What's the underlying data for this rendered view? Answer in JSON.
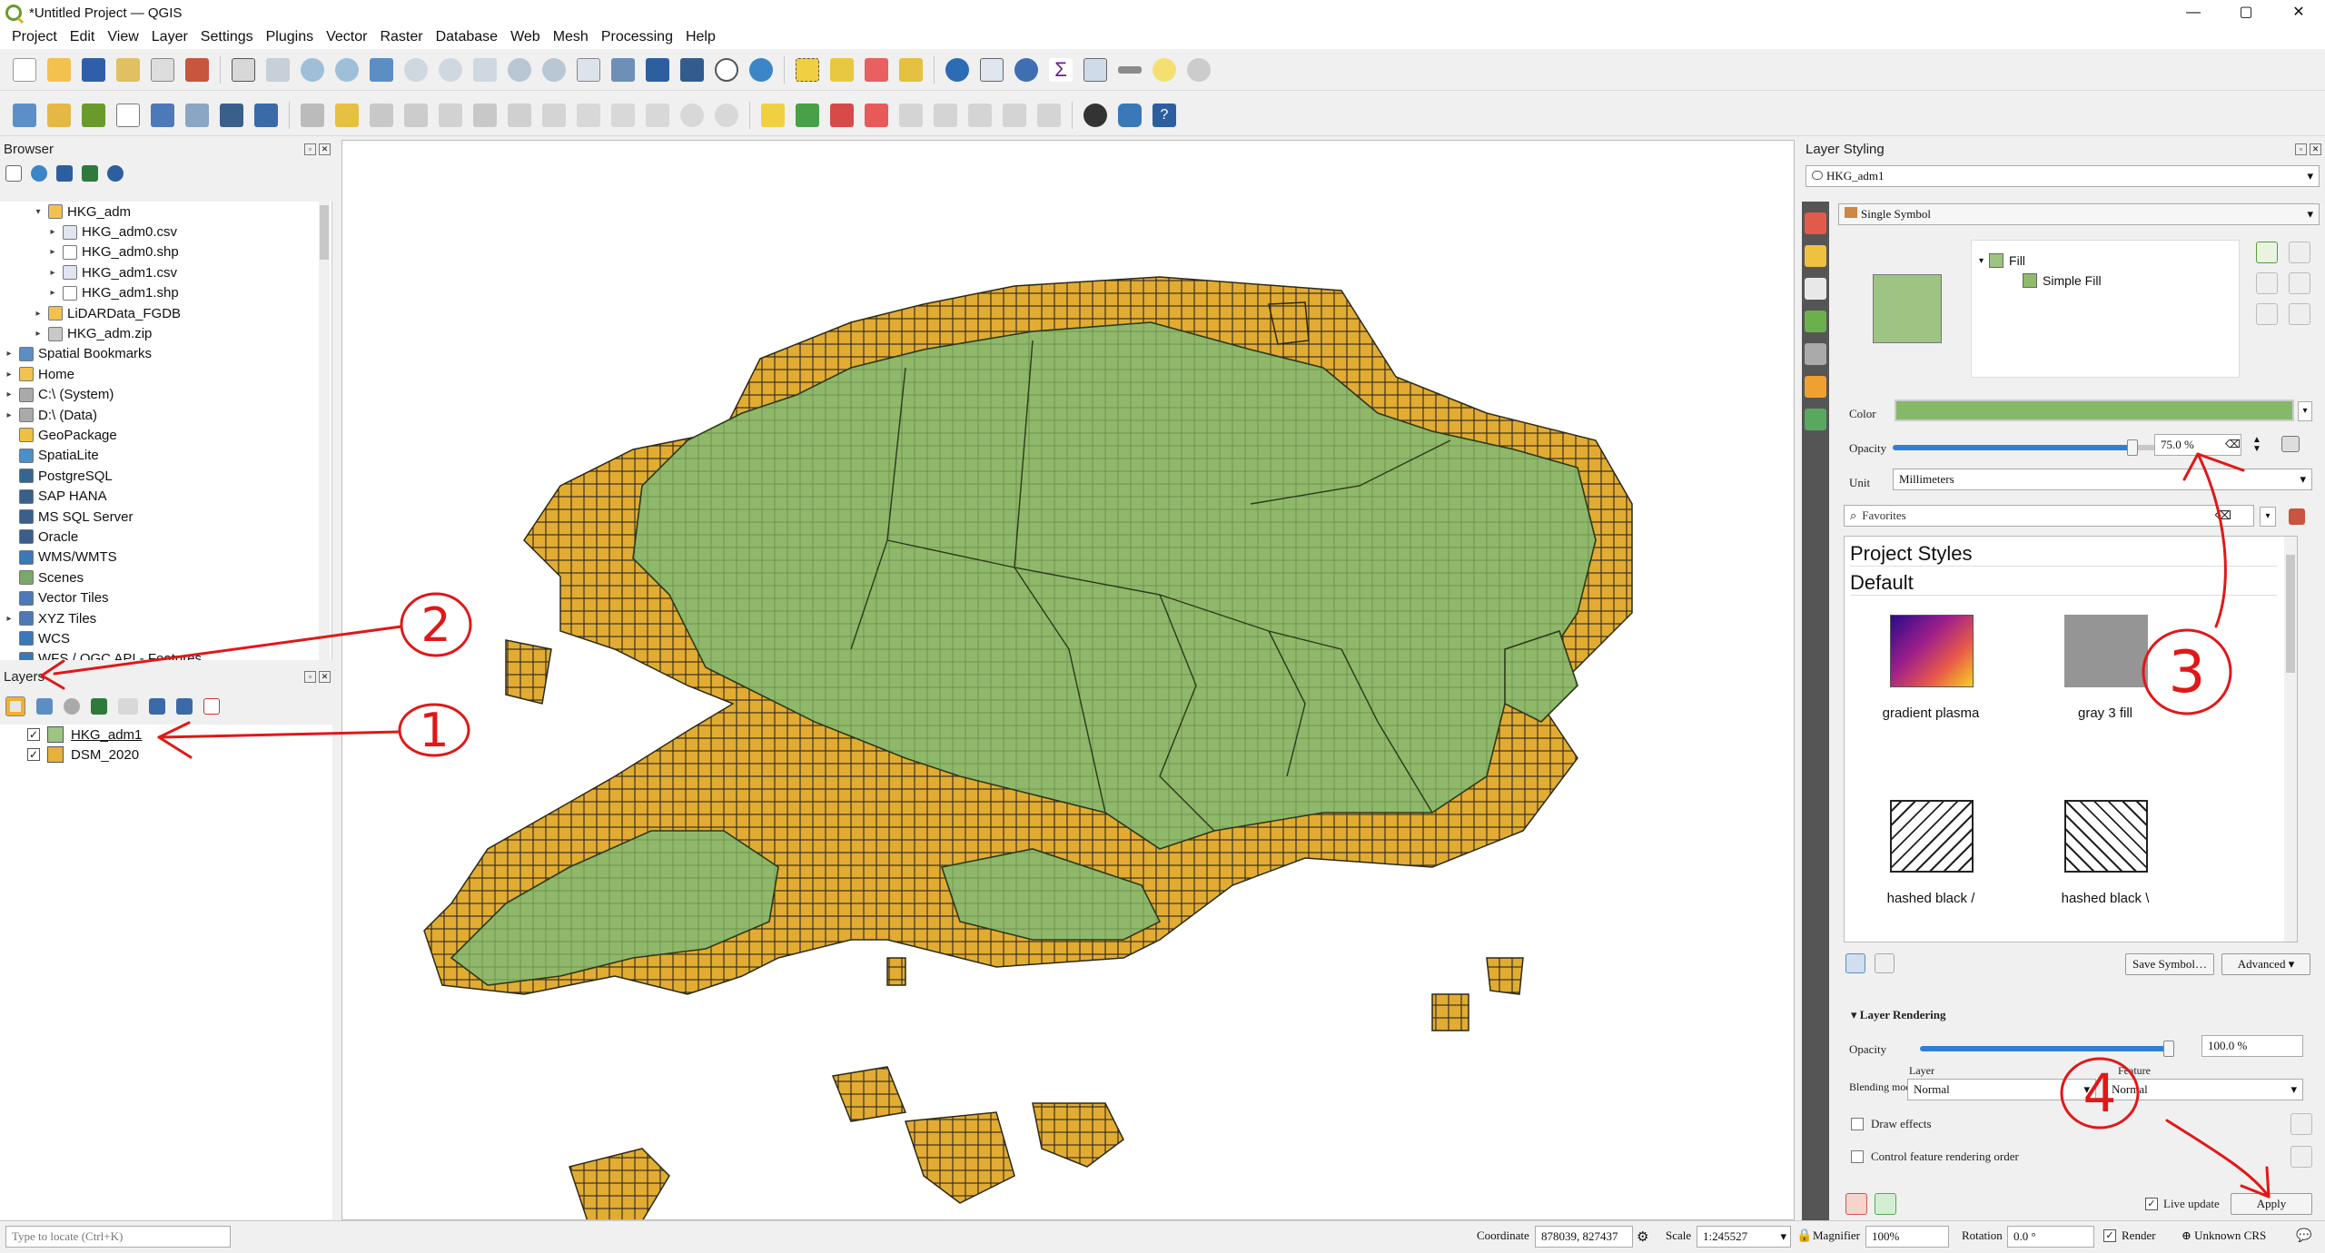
{
  "window": {
    "title": "*Untitled Project — QGIS",
    "minimize": "—",
    "maximize": "▢",
    "close": "✕"
  },
  "menu": [
    "Project",
    "Edit",
    "View",
    "Layer",
    "Settings",
    "Plugins",
    "Vector",
    "Raster",
    "Database",
    "Web",
    "Mesh",
    "Processing",
    "Help"
  ],
  "browser": {
    "title": "Browser",
    "items": [
      {
        "label": "HKG_adm",
        "arrow": "▾",
        "indent": 2,
        "icon": "folder-icon"
      },
      {
        "label": "HKG_adm0.csv",
        "arrow": "▸",
        "indent": 3,
        "icon": "table-icon"
      },
      {
        "label": "HKG_adm0.shp",
        "arrow": "▸",
        "indent": 3,
        "icon": "vector-icon"
      },
      {
        "label": "HKG_adm1.csv",
        "arrow": "▸",
        "indent": 3,
        "icon": "table-icon"
      },
      {
        "label": "HKG_adm1.shp",
        "arrow": "▸",
        "indent": 3,
        "icon": "vector-icon"
      },
      {
        "label": "LiDARData_FGDB",
        "arrow": "▸",
        "indent": 2,
        "icon": "folder-icon"
      },
      {
        "label": "HKG_adm.zip",
        "arrow": "▸",
        "indent": 2,
        "icon": "zip-icon"
      },
      {
        "label": "Spatial Bookmarks",
        "arrow": "▸",
        "indent": 0,
        "icon": "bookmark-icon"
      },
      {
        "label": "Home",
        "arrow": "▸",
        "indent": 0,
        "icon": "folder-icon"
      },
      {
        "label": "C:\\ (System)",
        "arrow": "▸",
        "indent": 0,
        "icon": "drive-icon"
      },
      {
        "label": "D:\\ (Data)",
        "arrow": "▸",
        "indent": 0,
        "icon": "drive-icon"
      },
      {
        "label": "GeoPackage",
        "arrow": "",
        "indent": 0,
        "icon": "geopackage-icon"
      },
      {
        "label": "SpatiaLite",
        "arrow": "",
        "indent": 0,
        "icon": "spatialite-icon"
      },
      {
        "label": "PostgreSQL",
        "arrow": "",
        "indent": 0,
        "icon": "postgresql-icon"
      },
      {
        "label": "SAP HANA",
        "arrow": "",
        "indent": 0,
        "icon": "database-icon"
      },
      {
        "label": "MS SQL Server",
        "arrow": "",
        "indent": 0,
        "icon": "database-icon"
      },
      {
        "label": "Oracle",
        "arrow": "",
        "indent": 0,
        "icon": "database-icon"
      },
      {
        "label": "WMS/WMTS",
        "arrow": "",
        "indent": 0,
        "icon": "globe-icon"
      },
      {
        "label": "Scenes",
        "arrow": "",
        "indent": 0,
        "icon": "scene-icon"
      },
      {
        "label": "Vector Tiles",
        "arrow": "",
        "indent": 0,
        "icon": "grid-icon"
      },
      {
        "label": "XYZ Tiles",
        "arrow": "▸",
        "indent": 0,
        "icon": "grid-icon"
      },
      {
        "label": "WCS",
        "arrow": "",
        "indent": 0,
        "icon": "globe-icon"
      },
      {
        "label": "WFS / OGC API - Features",
        "arrow": "",
        "indent": 0,
        "icon": "globe-icon"
      }
    ]
  },
  "layers": {
    "title": "Layers",
    "items": [
      {
        "name": "HKG_adm1",
        "checked": "✓",
        "color": "#9dc483"
      },
      {
        "name": "DSM_2020",
        "checked": "✓",
        "color": "#e8b23a"
      }
    ]
  },
  "styling": {
    "title": "Layer Styling",
    "layer": "HKG_adm1",
    "renderer": "Single Symbol",
    "symbol_tree": {
      "fill": "Fill",
      "simple_fill": "Simple Fill"
    },
    "color_label": "Color",
    "color": "#86b86a",
    "opacity_label": "Opacity",
    "opacity": "75.0 %",
    "unit_label": "Unit",
    "unit": "Millimeters",
    "search_placeholder": "Favorites",
    "groups": [
      "Project Styles",
      "Default"
    ],
    "styles": [
      {
        "name": "gradient  plasma",
        "kind": "gradient"
      },
      {
        "name": "gray 3 fill",
        "kind": "gray"
      },
      {
        "name": "hashed black /",
        "kind": "hatch-fwd"
      },
      {
        "name": "hashed black \\",
        "kind": "hatch-back"
      }
    ],
    "save_symbol": "Save Symbol…",
    "advanced": "Advanced",
    "layer_rendering": "Layer Rendering",
    "lr_opacity_label": "Opacity",
    "lr_opacity": "100.0 %",
    "blending_label": "Blending mode",
    "blend_layer_label": "Layer",
    "blend_layer": "Normal",
    "blend_feature_label": "Feature",
    "blend_feature": "Normal",
    "draw_effects": "Draw effects",
    "control_order": "Control feature rendering order",
    "live_update": "Live update",
    "apply": "Apply"
  },
  "status": {
    "locate_placeholder": "Type to locate (Ctrl+K)",
    "coordinate_label": "Coordinate",
    "coordinate": "878039, 827437",
    "scale_label": "Scale",
    "scale": "1:245527",
    "magnifier_label": "Magnifier",
    "magnifier": "100%",
    "rotation_label": "Rotation",
    "rotation": "0.0 °",
    "render_label": "Render",
    "crs": "Unknown CRS"
  },
  "annotations": [
    "1",
    "2",
    "3",
    "4"
  ],
  "map": {
    "land_color": "#8fb86a",
    "raster_color": "#e2ac32",
    "border_color": "#3a3a2a"
  }
}
